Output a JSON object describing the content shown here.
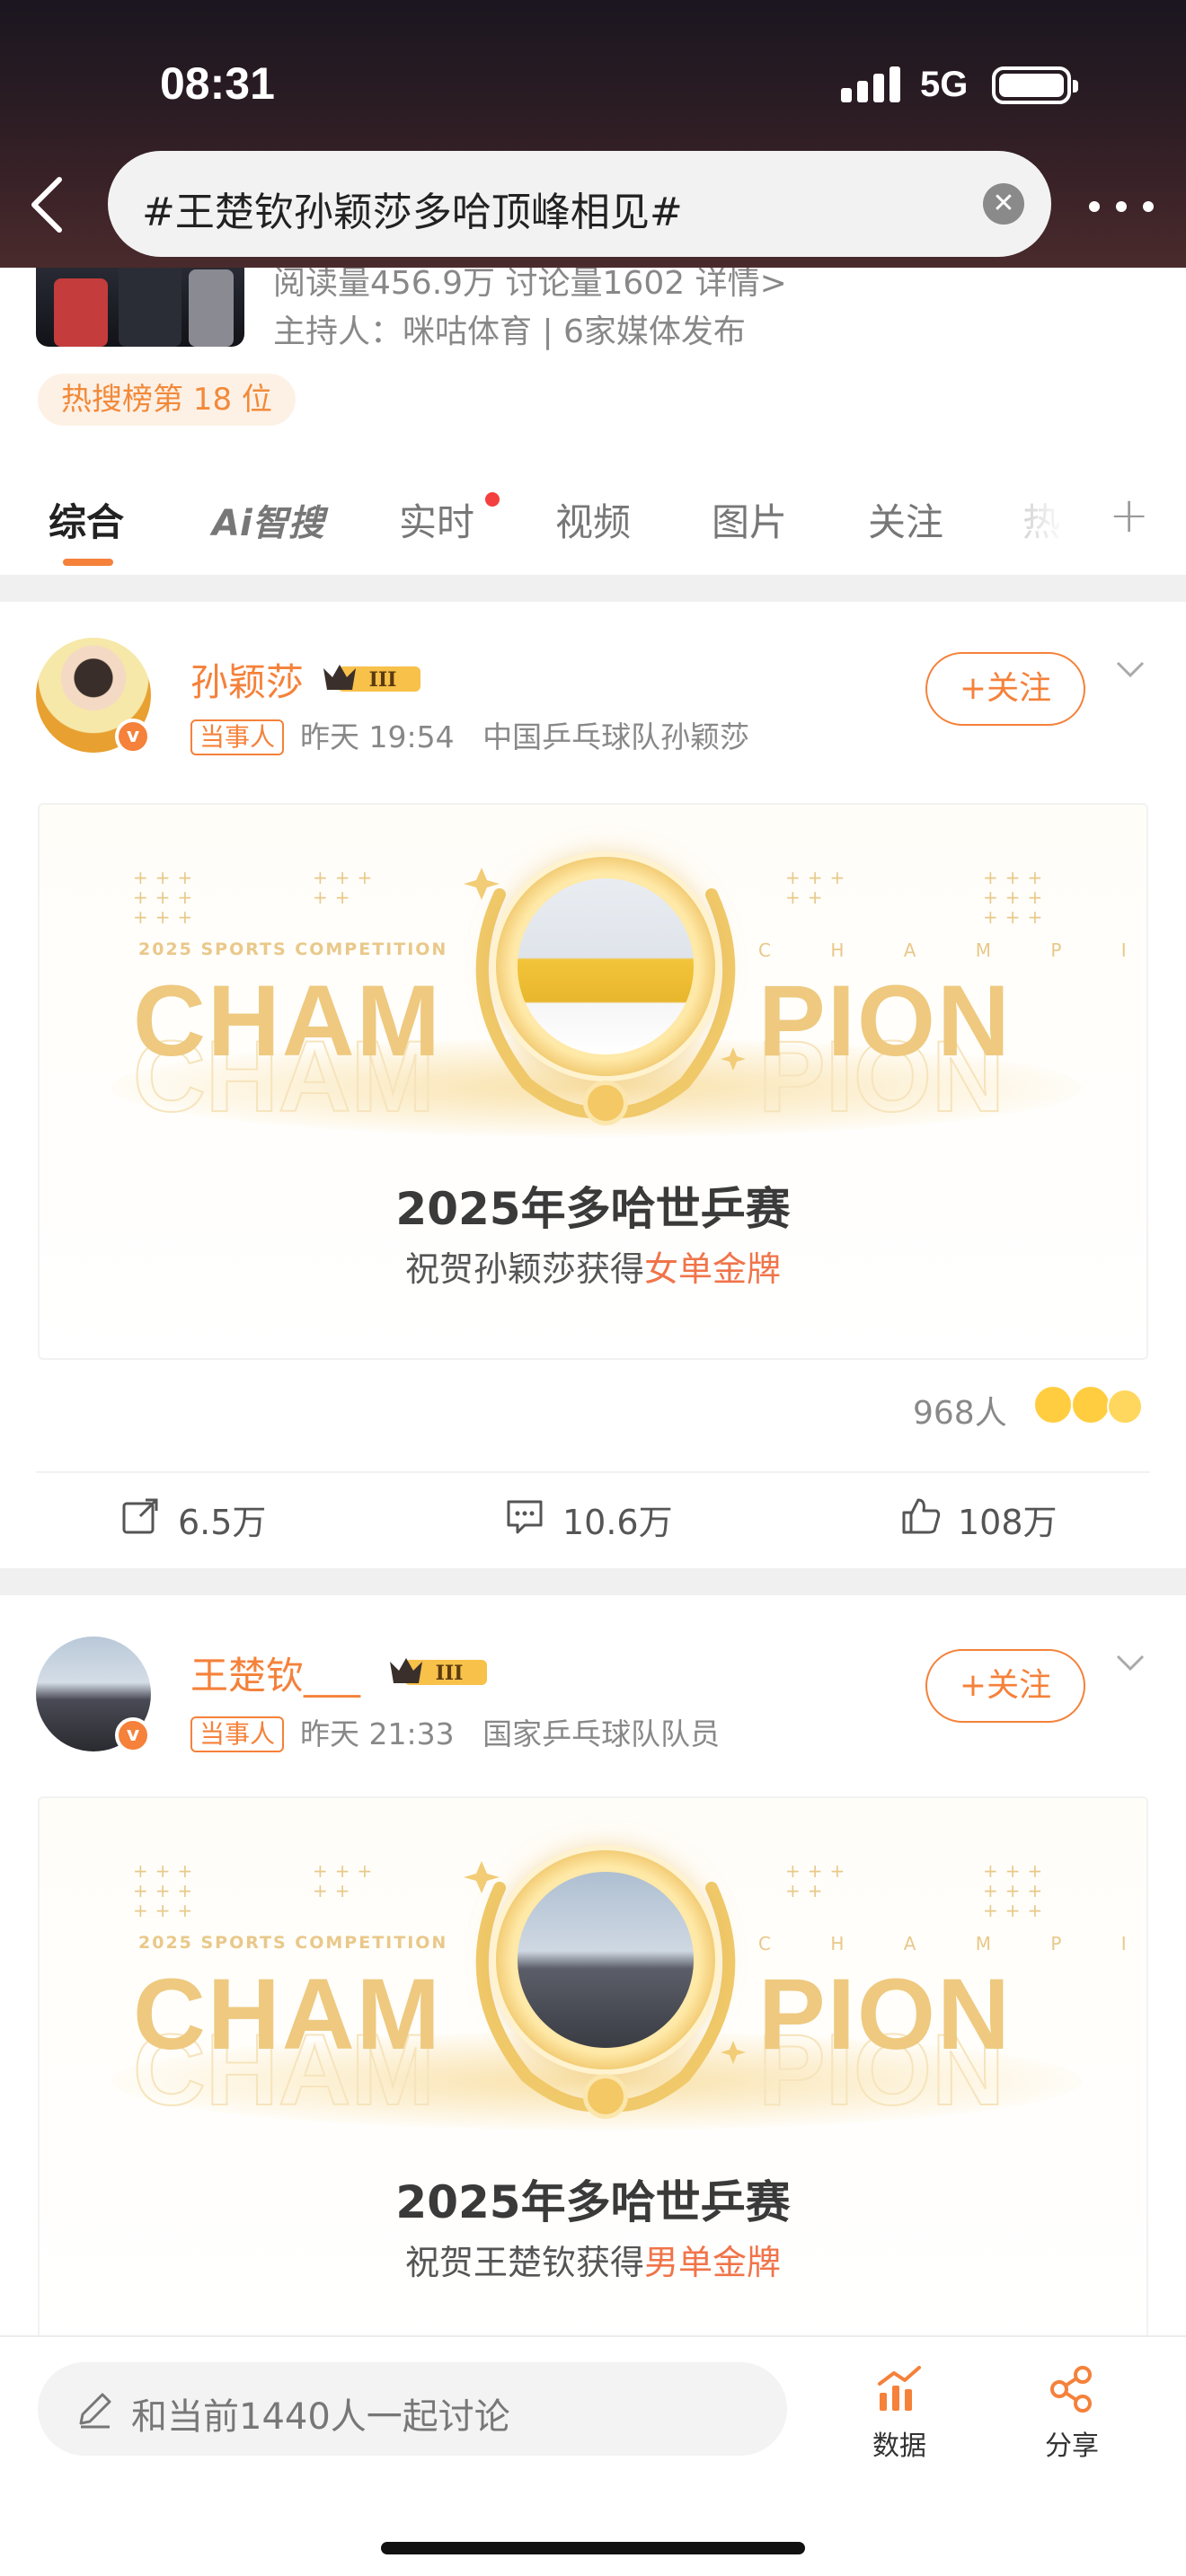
{
  "status_bar": {
    "time": "08:31",
    "network": "5G"
  },
  "header": {
    "search_query": "#王楚钦孙颖莎多哈顶峰相见#",
    "clear_icon": "clear-icon",
    "back_icon": "chevron-left-icon",
    "more_icon": "more-dots-icon"
  },
  "topic": {
    "stats": "阅读量456.9万  讨论量1602  详情>",
    "host": "主持人：咪咕体育 | 6家媒体发布",
    "rank": "热搜榜第 18 位"
  },
  "tabs": [
    {
      "label": "综合",
      "active": true
    },
    {
      "label": "Ai智搜"
    },
    {
      "label": "实时",
      "has_dot": true
    },
    {
      "label": "视频"
    },
    {
      "label": "图片"
    },
    {
      "label": "关注"
    },
    {
      "label": "热"
    }
  ],
  "posts": [
    {
      "author": "孙颖莎",
      "role": "当事人",
      "time": "昨天 19:54",
      "bio": "中国乒乓球队孙颖莎",
      "follow": "+关注",
      "card": {
        "sports_text": "2025 SPORTS COMPETITION",
        "champion_spaced": "C H A M P I O N",
        "word_left": "CHAM",
        "word_right": "PION",
        "title": "2025年多哈世乒赛",
        "sub_prefix": "祝贺孙颖莎获得",
        "sub_highlight": "女单金牌"
      },
      "reactions_count": "968人",
      "actions": {
        "share": "6.5万",
        "comment": "10.6万",
        "like": "108万"
      }
    },
    {
      "author": "王楚钦___",
      "role": "当事人",
      "time": "昨天 21:33",
      "bio": "国家乒乓球队队员",
      "follow": "+关注",
      "card": {
        "sports_text": "2025 SPORTS COMPETITION",
        "champion_spaced": "C H A M P I O N",
        "word_left": "CHAM",
        "word_right": "PION",
        "title": "2025年多哈世乒赛",
        "sub_prefix": "祝贺王楚钦获得",
        "sub_highlight": "男单金牌"
      }
    }
  ],
  "bottom_bar": {
    "comment_placeholder": "和当前1440人一起讨论",
    "data_label": "数据",
    "share_label": "分享"
  },
  "colors": {
    "accent": "#f5813a",
    "gold": "#eec97f",
    "highlight": "#f0744a"
  }
}
